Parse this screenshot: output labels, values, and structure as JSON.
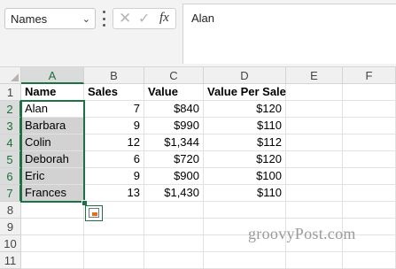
{
  "namebox": {
    "value": "Names"
  },
  "formula_bar": {
    "fx_label": "fx",
    "content": "Alan"
  },
  "columns": [
    "A",
    "B",
    "C",
    "D",
    "E",
    "F"
  ],
  "rows": [
    "1",
    "2",
    "3",
    "4",
    "5",
    "6",
    "7",
    "8",
    "9",
    "10",
    "11"
  ],
  "headers": {
    "a": "Name",
    "b": "Sales",
    "c": "Value",
    "d": "Value Per Sale"
  },
  "data_rows": [
    {
      "name": "Alan",
      "sales": "7",
      "value": "$840",
      "vps": "$120"
    },
    {
      "name": "Barbara",
      "sales": "9",
      "value": "$990",
      "vps": "$110"
    },
    {
      "name": "Colin",
      "sales": "12",
      "value": "$1,344",
      "vps": "$112"
    },
    {
      "name": "Deborah",
      "sales": "6",
      "value": "$720",
      "vps": "$120"
    },
    {
      "name": "Eric",
      "sales": "9",
      "value": "$900",
      "vps": "$100"
    },
    {
      "name": "Frances",
      "sales": "13",
      "value": "$1,430",
      "vps": "$110"
    }
  ],
  "watermark": "groovyPost.com",
  "colors": {
    "accent": "#1e7145",
    "selection": "#d2d2d2"
  }
}
